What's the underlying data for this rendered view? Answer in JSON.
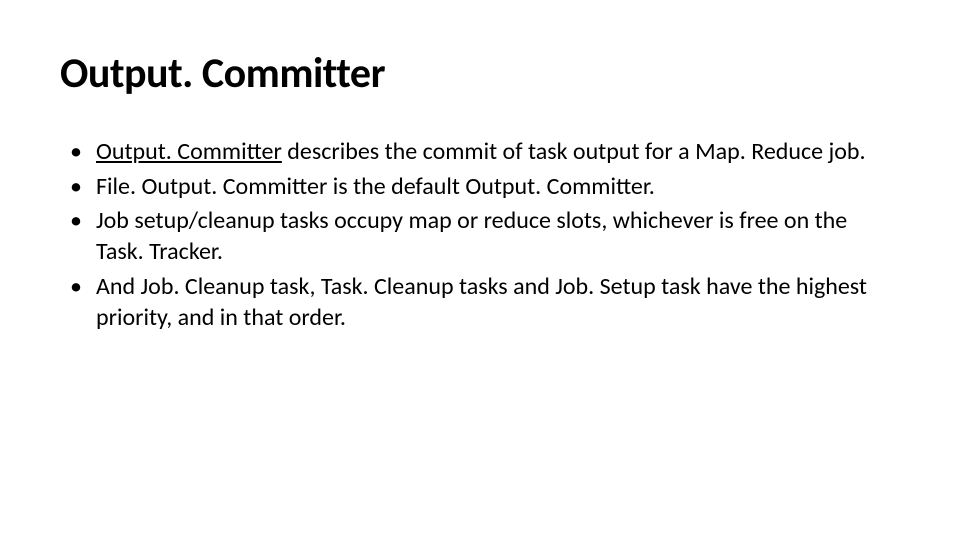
{
  "slide": {
    "title": "Output. Committer",
    "bullets": [
      {
        "link": "Output. Committer",
        "rest": " describes the commit of task output for a Map. Reduce job."
      },
      {
        "text": "File. Output. Committer is the default Output. Committer."
      },
      {
        "text": " Job setup/cleanup tasks occupy map or reduce slots, whichever is free on the Task. Tracker."
      },
      {
        "text": "And Job. Cleanup task, Task. Cleanup tasks and Job. Setup task have the highest priority, and in that order."
      }
    ]
  }
}
